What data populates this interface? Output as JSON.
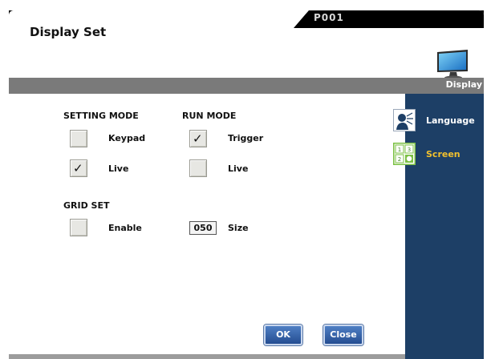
{
  "header": {
    "title": "Display Set",
    "page_code": "P001"
  },
  "panel": {
    "title": "Display"
  },
  "setting_mode": {
    "label": "SETTING MODE",
    "options": [
      {
        "label": "Keypad",
        "checked": false
      },
      {
        "label": "Live",
        "checked": true
      }
    ]
  },
  "run_mode": {
    "label": "RUN MODE",
    "options": [
      {
        "label": "Trigger",
        "checked": true
      },
      {
        "label": "Live",
        "checked": false
      }
    ]
  },
  "grid_set": {
    "label": "GRID SET",
    "enable_label": "Enable",
    "enable_checked": false,
    "size_value": "050",
    "size_label": "Size"
  },
  "buttons": {
    "ok": "OK",
    "close": "Close"
  },
  "sidebar": {
    "items": [
      {
        "label": "Language",
        "icon": "language-icon",
        "active": false,
        "color": "#ffffff"
      },
      {
        "label": "Screen",
        "icon": "screen-layout-icon",
        "active": true,
        "color": "#f2c12e",
        "icon_digits": [
          "1",
          "3",
          "2"
        ]
      }
    ]
  },
  "colors": {
    "sidebar_bg": "#1d3f66",
    "button_blue": "#244d91",
    "active_yellow": "#f2c12e",
    "active_green": "#7bc043"
  }
}
